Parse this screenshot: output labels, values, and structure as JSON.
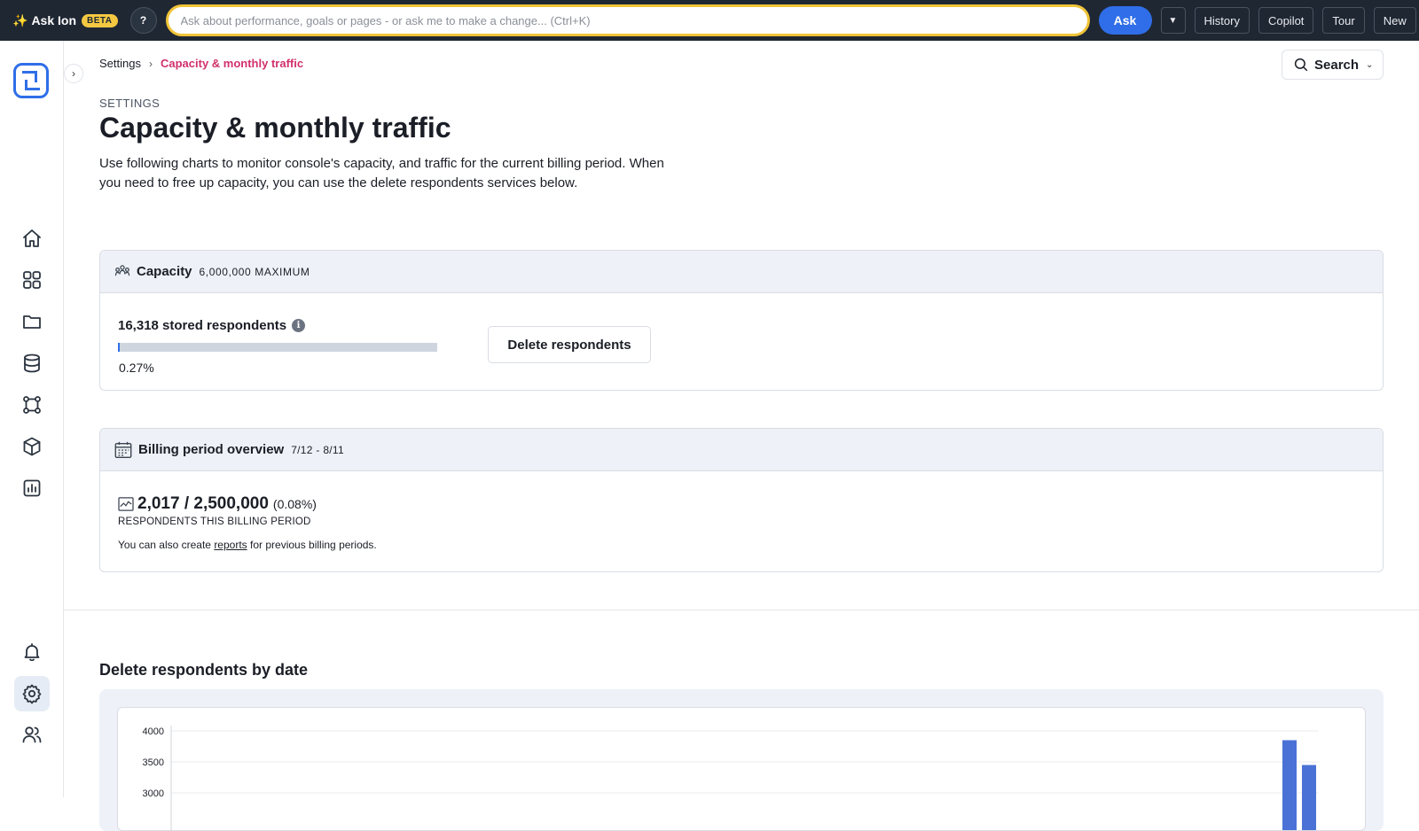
{
  "topbar": {
    "brand": "Ask Ion",
    "beta": "BETA",
    "help": "?",
    "ask_placeholder": "Ask about performance, goals or pages - or ask me to make a change... (Ctrl+K)",
    "ask_label": "Ask",
    "dropdown_label": "▼",
    "history": "History",
    "copilot": "Copilot",
    "tour": "Tour",
    "new": "New"
  },
  "breadcrumb": {
    "parent": "Settings",
    "current": "Capacity & monthly traffic"
  },
  "search": {
    "label": "Search"
  },
  "header": {
    "eyebrow": "SETTINGS",
    "title": "Capacity & monthly traffic",
    "description": "Use following charts to monitor console's capacity, and traffic for the current billing period. When you need to free up capacity, you can use the delete respondents services below."
  },
  "capacity": {
    "title": "Capacity",
    "max": "6,000,000 MAXIMUM",
    "stored": "16,318 stored respondents",
    "percent": "0.27%",
    "fill_fraction": 0.0027,
    "delete_label": "Delete respondents"
  },
  "billing": {
    "title": "Billing period overview",
    "period": "7/12 - 8/11",
    "count": "2,017 / 2,500,000",
    "percent": "(0.08%)",
    "label": "RESPONDENTS THIS BILLING PERIOD",
    "note_prefix": "You can also create",
    "note_link": "reports",
    "note_suffix": "for previous billing periods."
  },
  "delete_chart_section": {
    "title": "Delete respondents by date"
  },
  "chart_data": {
    "type": "bar",
    "title": "",
    "xlabel": "",
    "ylabel": "",
    "ylim": [
      0,
      4000
    ],
    "yticks": [
      4000,
      3500,
      3000
    ],
    "grid": true,
    "series": [
      {
        "values": [
          3850,
          3450
        ]
      }
    ],
    "accent_color": "#4a72d6"
  }
}
